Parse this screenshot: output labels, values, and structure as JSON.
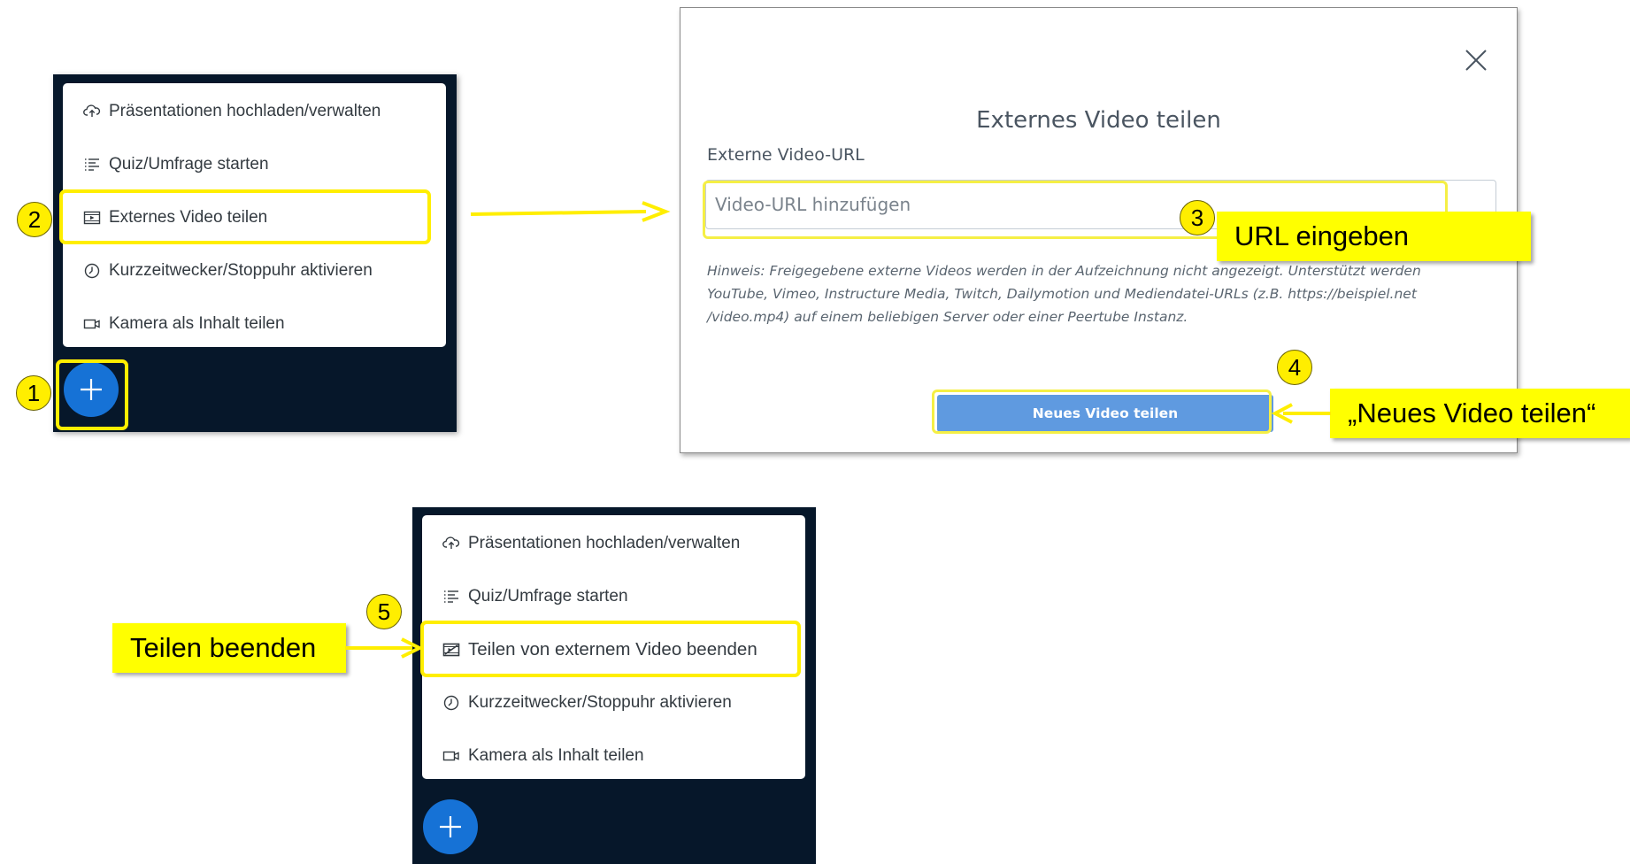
{
  "menu_top": {
    "items": [
      {
        "icon": "upload-cloud-icon",
        "label": "Präsentationen hochladen/verwalten"
      },
      {
        "icon": "list-icon",
        "label": "Quiz/Umfrage starten"
      },
      {
        "icon": "video-play-icon",
        "label": "Externes Video teilen"
      },
      {
        "icon": "clock-icon",
        "label": "Kurzzeitwecker/Stoppuhr aktivieren"
      },
      {
        "icon": "camera-icon",
        "label": "Kamera als Inhalt teilen"
      }
    ],
    "plus_icon": "plus-icon"
  },
  "menu_bottom": {
    "items": [
      {
        "icon": "upload-cloud-icon",
        "label": "Präsentationen hochladen/verwalten"
      },
      {
        "icon": "list-icon",
        "label": "Quiz/Umfrage starten"
      },
      {
        "icon": "video-stop-icon",
        "label": "Teilen von externem Video beenden"
      },
      {
        "icon": "clock-icon",
        "label": "Kurzzeitwecker/Stoppuhr aktivieren"
      },
      {
        "icon": "camera-icon",
        "label": "Kamera als Inhalt teilen"
      }
    ],
    "plus_icon": "plus-icon"
  },
  "modal": {
    "title": "Externes Video teilen",
    "field_label": "Externe Video-URL",
    "input_placeholder": "Video-URL hinzufügen",
    "input_value": "",
    "hint": "Hinweis: Freigegebene externe Videos werden in der Aufzeichnung nicht angezeigt. Unterstützt werden YouTube, Vimeo, Instructure Media, Twitch, Dailymotion und Mediendatei-URLs (z.B. https://beispiel.net /video.mp4) auf einem beliebigen Server oder einer Peertube Instanz.",
    "submit_label": "Neues Video teilen",
    "close_icon": "close-icon"
  },
  "steps": [
    "1",
    "2",
    "3",
    "4",
    "5"
  ],
  "callouts": {
    "url": "URL eingeben",
    "share": "„Neues Video teilen“",
    "stop": "Teilen beenden"
  },
  "colors": {
    "highlight": "#ffee00",
    "panel_bg": "#06172a",
    "plus_button": "#1672d6",
    "share_button": "#5f9ae0"
  }
}
